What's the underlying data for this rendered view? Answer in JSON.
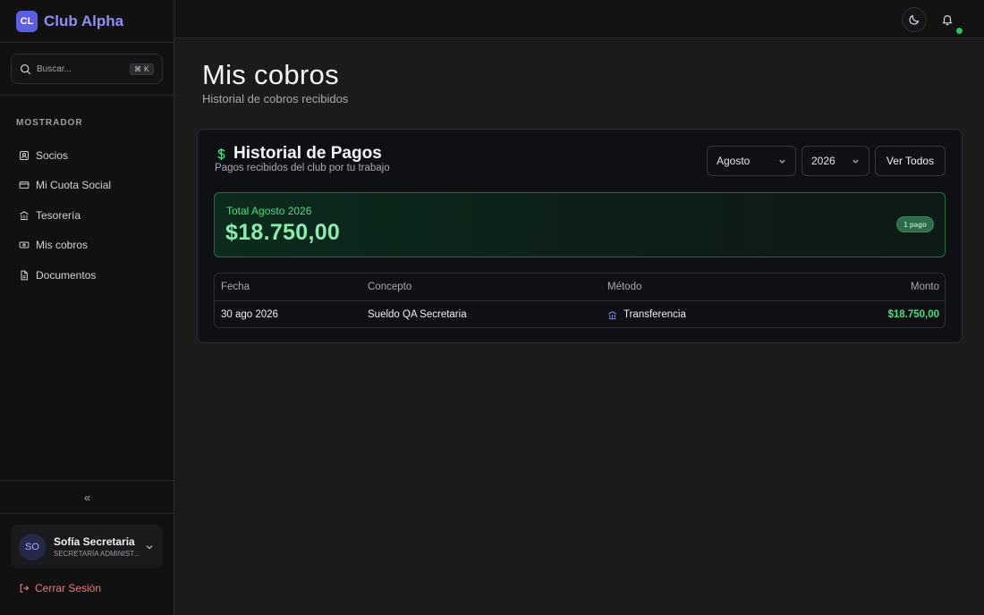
{
  "brand": {
    "logo_text": "CL",
    "name": "Club Alpha"
  },
  "search": {
    "placeholder": "Buscar...",
    "shortcut": "⌘ K"
  },
  "sidebar": {
    "section_label": "MOSTRADOR",
    "items": [
      {
        "label": "Socios",
        "icon": "users-icon"
      },
      {
        "label": "Mi Cuota Social",
        "icon": "credit-card-icon"
      },
      {
        "label": "Tesorería",
        "icon": "bank-icon"
      },
      {
        "label": "Mis cobros",
        "icon": "banknote-icon"
      },
      {
        "label": "Documentos",
        "icon": "document-icon"
      }
    ],
    "collapse_glyph": "«"
  },
  "user": {
    "initials": "SO",
    "name": "Sofía Secretaria",
    "role": "SECRETARÍA ADMINIST..."
  },
  "logout": {
    "label": "Cerrar Sesión"
  },
  "page": {
    "title": "Mis cobros",
    "subtitle": "Historial de cobros recibidos"
  },
  "history": {
    "title": "Historial de Pagos",
    "subtitle": "Pagos recibidos del club por tu trabajo",
    "month_select": "Agosto",
    "year_select": "2026",
    "view_all_label": "Ver Todos",
    "total_label": "Total Agosto 2026",
    "total_value": "$18.750,00",
    "count_badge": "1 pago",
    "columns": [
      "Fecha",
      "Concepto",
      "Método",
      "Monto"
    ],
    "rows": [
      {
        "date": "30 ago 2026",
        "concept": "Sueldo QA Secretaria",
        "method": "Transferencia",
        "amount": "$18.750,00"
      }
    ]
  },
  "colors": {
    "accent": "#5b5ee6",
    "success": "#4ade80",
    "danger": "#e87a7a"
  }
}
